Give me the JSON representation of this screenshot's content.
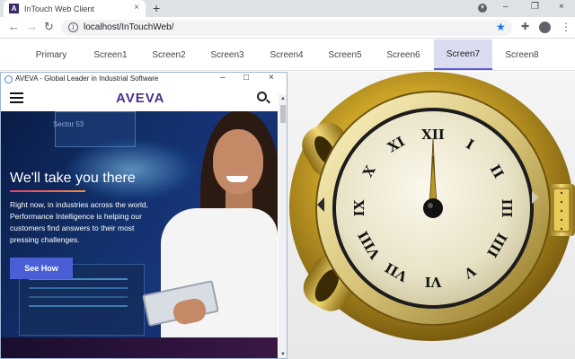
{
  "browser": {
    "tab_title": "InTouch Web Client",
    "tab_favicon_letter": "A",
    "tab_close": "×",
    "new_tab": "+",
    "url": "localhost/InTouchWeb/",
    "back": "←",
    "forward": "→",
    "reload": "C",
    "star": "★",
    "extensions": "✚",
    "menu": "⋮",
    "minimize": "–",
    "restore": "❐",
    "close": "×",
    "info": "i"
  },
  "screen_tabs": {
    "active": "Screen7",
    "items": [
      "Primary",
      "Screen1",
      "Screen2",
      "Screen3",
      "Screen4",
      "Screen5",
      "Screen6",
      "Screen7",
      "Screen8"
    ]
  },
  "left_window": {
    "title": "AVEVA - Global Leader in Industrial Software",
    "minimize": "–",
    "maximize": "□",
    "close": "×"
  },
  "site": {
    "logo": "AVEVA",
    "sector_label": "Sector 53",
    "hero_heading": "We'll take you there",
    "hero_body": "Right now, in industries across the world, Performance Intelligence is helping our customers find answers to their most pressing challenges.",
    "cta": "See How"
  },
  "clock": {
    "hour": 12,
    "minute": 0,
    "numerals": [
      "XII",
      "I",
      "II",
      "III",
      "IIII",
      "V",
      "VI",
      "VII",
      "VIII",
      "IX",
      "X",
      "XI"
    ],
    "colors": {
      "case": "#c9a227",
      "bezel": "#f2e9b8",
      "face": "#ece7cf",
      "ink": "#141414",
      "hand": "#b9962a"
    }
  }
}
